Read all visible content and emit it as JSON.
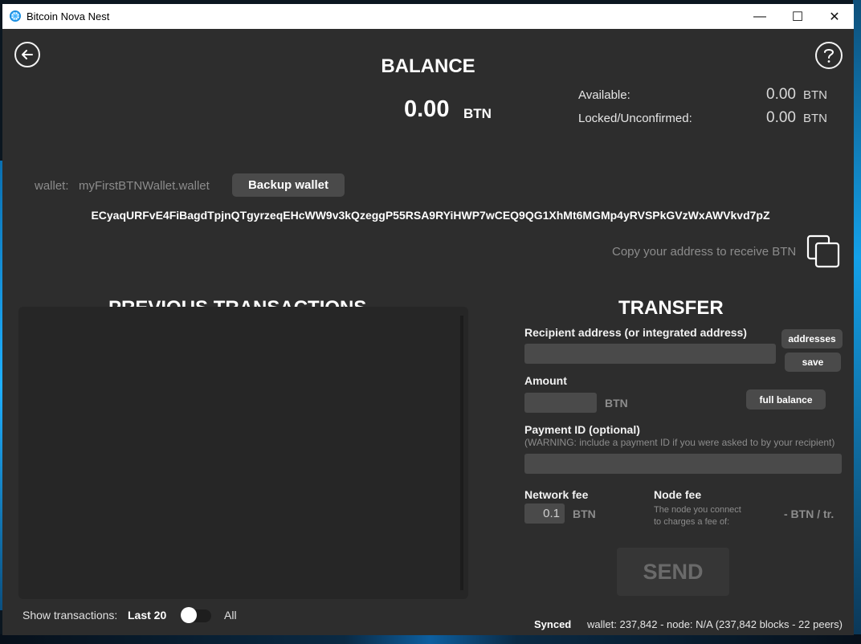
{
  "window": {
    "title": "Bitcoin Nova Nest",
    "minimize_glyph": "—",
    "maximize_glyph": "☐",
    "close_glyph": "✕"
  },
  "header": {
    "back_icon": "back-arrow-icon",
    "help_icon": "question-icon"
  },
  "balance": {
    "title": "BALANCE",
    "amount": "0.00",
    "unit": "BTN",
    "available_label": "Available:",
    "available_value": "0.00",
    "available_unit": "BTN",
    "locked_label": "Locked/Unconfirmed:",
    "locked_value": "0.00",
    "locked_unit": "BTN"
  },
  "wallet": {
    "label": "wallet:",
    "name": "myFirstBTNWallet.wallet",
    "backup_button": "Backup wallet",
    "address": "ECyaqURFvE4FiBagdTpjnQTgyrzeqEHcWW9v3kQzeggP55RSA9RYiHWP7wCEQ9QG1XhMt6MGMp4yRVSPkGVzWxAWVkvd7pZ",
    "copy_hint": "Copy your address to receive BTN",
    "copy_icon": "copy-icon"
  },
  "transactions": {
    "title": "PREVIOUS TRANSACTIONS",
    "show_label": "Show transactions:",
    "option_last": "Last 20",
    "option_all": "All",
    "toggle_state": "Last 20"
  },
  "transfer": {
    "title": "TRANSFER",
    "recipient_label": "Recipient address (or integrated address)",
    "recipient_value": "",
    "addresses_button": "addresses",
    "save_button": "save",
    "amount_label": "Amount",
    "amount_value": "",
    "amount_unit": "BTN",
    "full_balance_button": "full balance",
    "payment_id_label": "Payment ID (optional)",
    "payment_id_warning": "(WARNING: include a payment ID if you were asked to by your recipient)",
    "payment_id_value": "",
    "network_fee_label": "Network fee",
    "network_fee_value": "0.1",
    "network_fee_unit": "BTN",
    "node_fee_label": "Node fee",
    "node_fee_desc_line1": "The node you connect",
    "node_fee_desc_line2": "to charges a fee of:",
    "node_fee_value": "-  BTN / tr.",
    "send_button": "SEND"
  },
  "status": {
    "synced": "Synced",
    "info": "wallet: 237,842 - node: N/A  (237,842 blocks - 22 peers)"
  },
  "colors": {
    "window_bg": "#2d2d2d",
    "panel_bg": "#262626",
    "field_bg": "#4a4a4a",
    "muted_text": "#8c8c8c"
  }
}
